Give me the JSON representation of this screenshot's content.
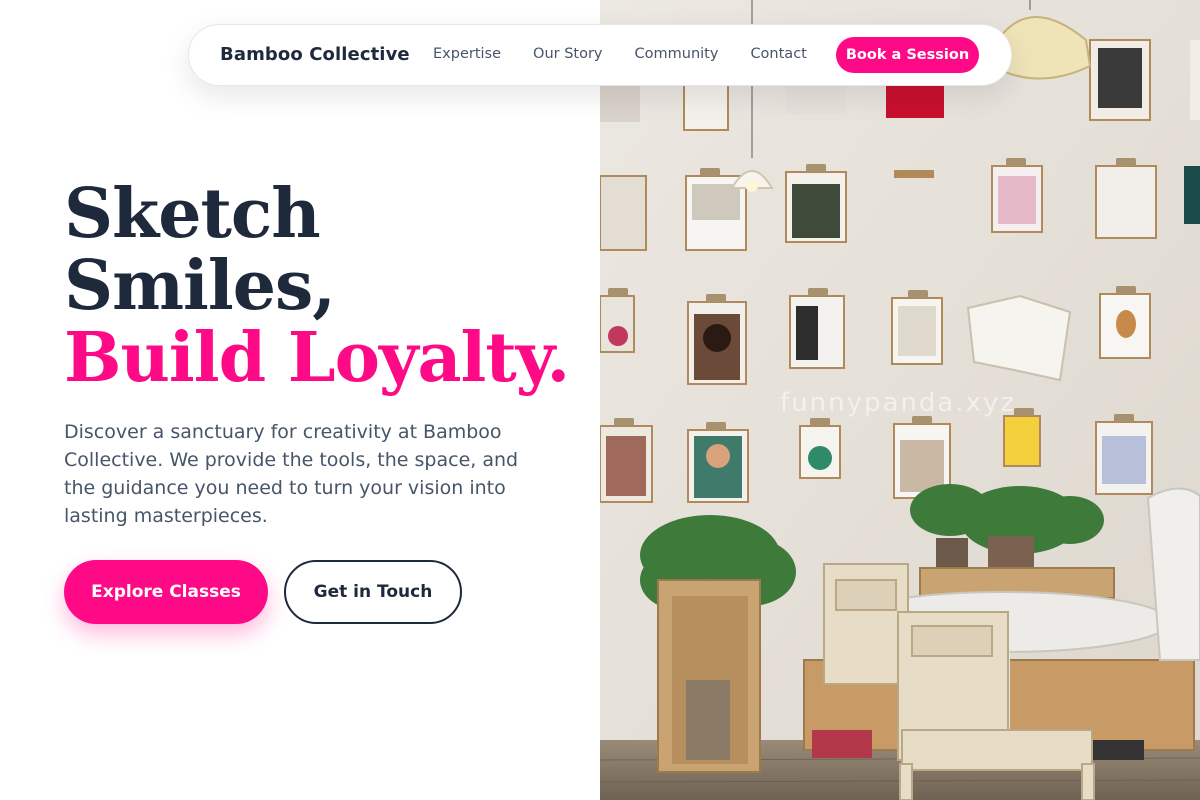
{
  "nav": {
    "brand": "Bamboo Collective",
    "links": [
      "Expertise",
      "Our Story",
      "Community",
      "Contact"
    ],
    "cta": "Book a Session"
  },
  "hero": {
    "title_line1": "Sketch",
    "title_line2": "Smiles,",
    "title_accent": "Build Loyalty.",
    "description": "Discover a sanctuary for creativity at Bamboo Collective. We provide the tools, the space, and the guidance you need to turn your vision into lasting masterpieces.",
    "primary_button": "Explore Classes",
    "secondary_button": "Get in Touch"
  },
  "watermark": "funnypanda.xyz",
  "colors": {
    "accent": "#ff0a86",
    "heading": "#1e293b",
    "body": "#475569"
  }
}
